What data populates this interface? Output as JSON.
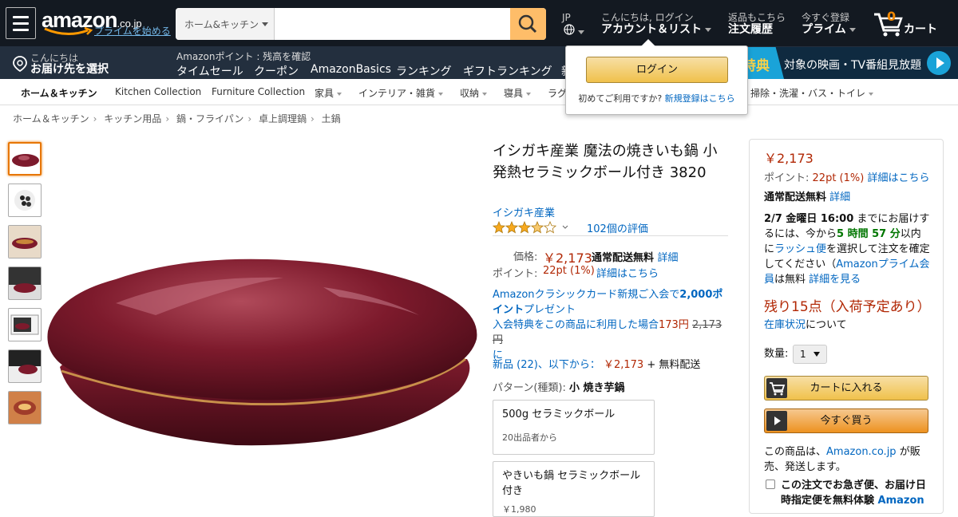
{
  "nav": {
    "logo": "amazon",
    "logo_tld": ".co.jp",
    "prime_link": "プライムを始める",
    "search_category": "ホーム&キッチン",
    "search_placeholder": "",
    "lang": "JP",
    "greeting": "こんにちは, ログイン",
    "account": "アカウント＆リスト",
    "returns_small": "返品もこちら",
    "orders": "注文履歴",
    "prime_small": "今すぐ登録",
    "prime": "プライム",
    "cart_count": "0",
    "cart": "カート"
  },
  "subnav": {
    "deliver_small": "こんにちは",
    "deliver": "お届け先を選択",
    "points": "Amazonポイント : 残高を確認",
    "links": [
      "タイムセール",
      "クーポン",
      "AmazonBasics",
      "ランキング",
      "ギフトランキング",
      "新"
    ],
    "promo_badge": "特典",
    "promo_text": "対象の映画・TV番組見放題"
  },
  "categories": [
    "ホーム＆キッチン",
    "Kitchen Collection",
    "Furniture Collection",
    "家具",
    "インテリア・雑貨",
    "収納",
    "寝具",
    "ラグ",
    "掃除・洗濯・バス・トイレ"
  ],
  "flyout": {
    "login": "ログイン",
    "new_customer": "初めてご利用ですか?",
    "register": "新規登録はこちら"
  },
  "breadcrumb": [
    "ホーム＆キッチン",
    "キッチン用品",
    "鍋・フライパン",
    "卓上調理鍋",
    "土鍋"
  ],
  "product": {
    "title": "イシガキ産業 魔法の焼きいも鍋 小 発熱セラミックボール付き 3820",
    "brand": "イシガキ産業",
    "rating": 3.5,
    "reviews": "102個の評価",
    "price_label": "価格:",
    "price": "￥2,173",
    "shipping": "通常配送無料",
    "details": "詳細",
    "points_label": "ポイント:",
    "points": "22pt  (1%)",
    "points_link": "詳細はこちら",
    "classic_1": "Amazonクラシックカード新規ご入会で",
    "classic_bold": "2,000ポイント",
    "classic_2": "プレゼント",
    "classic_3": "入会特典をこの商品に利用した場合",
    "classic_price": "173円",
    "classic_strike": "2,173円",
    "classic_4": "に",
    "new_link": "新品 (22)、以下から：",
    "new_price": "￥2,173",
    "new_ship": "+ 無料配送",
    "pattern_label": "パターン(種類):",
    "pattern_value": "小 焼き芋鍋",
    "options": [
      {
        "name": "500g セラミックボール",
        "sub": "20出品者から"
      },
      {
        "name": "やきいも鍋 セラミックボール付き",
        "sub": "￥1,980"
      }
    ]
  },
  "buybox": {
    "price": "￥2,173",
    "points_label": "ポイント:",
    "points": "22pt  (1%)",
    "points_link": "詳細はこちら",
    "shipping": "通常配送無料",
    "shipping_link": "詳細",
    "delivery_date": "2/7 金曜日 16:00",
    "delivery_1": "までにお届けするには、今から",
    "countdown": "5 時間 57 分",
    "delivery_2": "以内に",
    "rush": "ラッシュ便",
    "delivery_3": "を選択して注文を確定してください（",
    "prime_member": "Amazonプライム会員",
    "delivery_4": "は無料",
    "see_more": "詳細を見る",
    "stock": "残り15点（入荷予定あり）",
    "stock_link": "在庫状況",
    "stock_suffix": "について",
    "qty_label": "数量:",
    "qty": "1",
    "add_to_cart": "カートに入れる",
    "buy_now": "今すぐ買う",
    "seller_1": "この商品は、",
    "seller_link": "Amazon.co.jp",
    "seller_2": "が販売、発送します。",
    "rush_text": "この注文でお急ぎ便、お届け日時指定便を無料体験",
    "rush_link": "Amazon"
  },
  "colors": {
    "nav_bg": "#131921",
    "subnav_bg": "#232f3e",
    "accent": "#febd69",
    "price": "#b12704",
    "link": "#0066c0",
    "product": "#7d1a2c"
  }
}
